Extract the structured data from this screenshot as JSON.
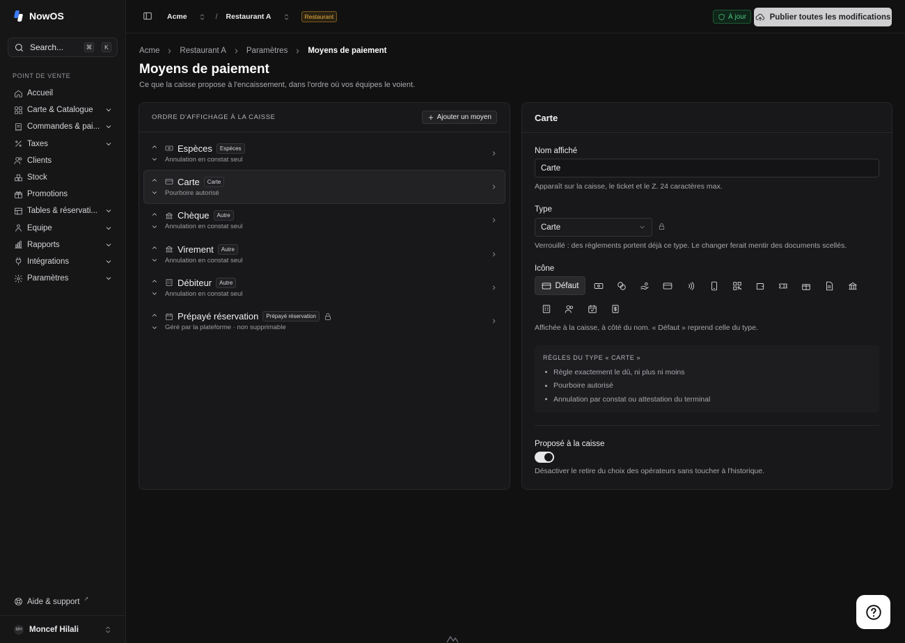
{
  "app": {
    "name": "NowOS"
  },
  "search": {
    "label": "Search...",
    "kbd1": "⌘",
    "kbd2": "K"
  },
  "sidebar": {
    "section": "POINT DE VENTE",
    "items": [
      {
        "label": "Accueil",
        "icon": "home-icon"
      },
      {
        "label": "Carte & Catalogue",
        "icon": "grid-icon"
      },
      {
        "label": "Commandes & pai...",
        "icon": "receipt-icon"
      },
      {
        "label": "Taxes",
        "icon": "percent-icon"
      },
      {
        "label": "Clients",
        "icon": "users-icon"
      },
      {
        "label": "Stock",
        "icon": "boxes-icon"
      },
      {
        "label": "Promotions",
        "icon": "gift-icon"
      },
      {
        "label": "Tables & réservati...",
        "icon": "table-icon"
      },
      {
        "label": "Équipe",
        "icon": "team-icon"
      },
      {
        "label": "Rapports",
        "icon": "chart-icon"
      },
      {
        "label": "Intégrations",
        "icon": "plug-icon"
      },
      {
        "label": "Paramètres",
        "icon": "gear-icon"
      }
    ],
    "help": "Aide & support",
    "help_ext": "↗",
    "user": {
      "initials": "MH",
      "name": "Moncef Hilali"
    }
  },
  "topbar": {
    "org": "Acme",
    "sep": "/",
    "venue": "Restaurant A",
    "venue_tag": "Restaurant",
    "sync": "À jour",
    "publish": "Publier toutes les modifications"
  },
  "breadcrumb": [
    "Acme",
    "Restaurant A",
    "Paramètres",
    "Moyens de paiement"
  ],
  "page": {
    "title": "Moyens de paiement",
    "subtitle": "Ce que la caisse propose à l'encaissement, dans l'ordre où vos équipes le voient."
  },
  "list": {
    "title": "ORDRE D'AFFICHAGE À LA CAISSE",
    "add": "Ajouter un moyen",
    "items": [
      {
        "name": "Espèces",
        "tag": "Espèces",
        "sub": "Annulation en constat seul",
        "icon": "banknote-icon"
      },
      {
        "name": "Carte",
        "tag": "Carte",
        "sub": "Pourboire autorisé",
        "icon": "credit-card-icon"
      },
      {
        "name": "Chèque",
        "tag": "Autre",
        "sub": "Annulation en constat seul",
        "icon": "bank-icon"
      },
      {
        "name": "Virement",
        "tag": "Autre",
        "sub": "Annulation en constat seul",
        "icon": "bank-icon"
      },
      {
        "name": "Débiteur",
        "tag": "Autre",
        "sub": "Annulation en constat seul",
        "icon": "building-icon"
      },
      {
        "name": "Prépayé réservation",
        "tag": "Prépayé réservation",
        "sub": "Géré par la plateforme · non supprimable",
        "icon": "calendar-icon"
      }
    ]
  },
  "detail": {
    "title": "Carte",
    "name_label": "Nom affiché",
    "name_value": "Carte",
    "name_hint": "Apparaît sur la caisse, le ticket et le Z. 24 caractères max.",
    "type_label": "Type",
    "type_value": "Carte",
    "type_hint": "Verrouillé : des règlements portent déjà ce type. Le changer ferait mentir des documents scellés.",
    "icon_label": "Icône",
    "icon_default": "Défaut",
    "icon_hint": "Affichée à la caisse, à côté du nom. « Défaut » reprend celle du type.",
    "rules_title": "RÈGLES DU TYPE « CARTE »",
    "rules": [
      "Règle exactement le dû, ni plus ni moins",
      "Pourboire autorisé",
      "Annulation par constat ou attestation du terminal"
    ],
    "toggle_label": "Proposé à la caisse",
    "toggle_on": true,
    "toggle_hint": "Désactiver le retire du choix des opérateurs sans toucher à l'historique."
  },
  "colors": {
    "accent_sync": "#4cc27a",
    "tag_restaurant": "#e8b341",
    "logo_blue": "#3b7bf6"
  }
}
